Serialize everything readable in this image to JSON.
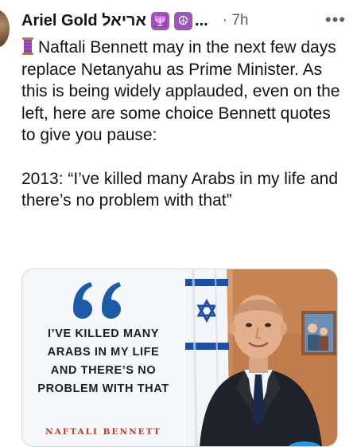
{
  "tweet": {
    "author_name": "Ariel Gold",
    "author_name_hebrew": "אריאל",
    "emoji_menorah": "🕎",
    "emoji_peace": "☮",
    "name_ellipsis": "...",
    "separator": "·",
    "timestamp": "7h",
    "more_label": "•••",
    "paragraph_1": "Naftali Bennett may in the next few days replace Netanyahu as Prime Minister. As this is being widely applauded, even on the left, here are some choice Bennett quotes to give you pause:",
    "paragraph_2": "2013: “I’ve killed many Arabs in my life and there’s no problem with that”"
  },
  "media": {
    "quote_text": "I’ve killed many Arabs in my life and there’s no problem with that",
    "attribution": "NAFTALI BENNETT",
    "quote_color": "#1e5aa8",
    "attribution_color": "#c0392b"
  },
  "icons": {
    "thread_icon": "spool-of-thread-icon",
    "more_icon": "more-options-icon",
    "quote_icon": "quotation-mark-icon"
  }
}
